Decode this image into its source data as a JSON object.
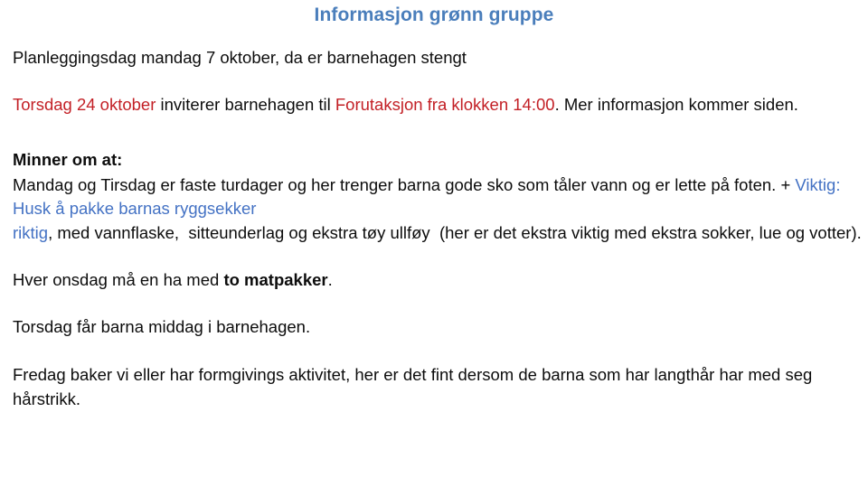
{
  "document": {
    "title": "Informasjon grønn gruppe",
    "title_color": "#4A7EBB",
    "accent_red": "#C32026",
    "accent_blue": "#4472C4",
    "body_color": "#0D0D0D",
    "background": "#FFFFFF"
  },
  "paragraphs": {
    "planning_day": "Planleggingsdag mandag 7 oktober, da er barnehagen stengt",
    "invitation": {
      "date_red": "Torsdag 24 oktober",
      "middle_black": " inviterer barnehagen til ",
      "event_red": "Forutaksjon fra klokken 14:00",
      "tail_black": ". Mer informasjon kommer siden."
    },
    "reminder_heading": "Minner om at:",
    "shoes": {
      "lead_black": "Mandag og Tirsdag er faste turdager og her trenger barna gode sko som tåler vann og er lette på foten. + ",
      "important_blue": "Viktig: Husk å pakke barnas ryggsekker riktig",
      "tail_black": ", med vannflaske,  sitteunderlag og ekstra tøy ullføy  (her er det ekstra viktig med ekstra sokker, lue og votter)."
    },
    "wednesday": {
      "lead": "Hver onsdag må en ha med ",
      "bold": "to matpakker",
      "tail": "."
    },
    "thursday": "Torsdag får barna middag i barnehagen.",
    "friday": "Fredag baker vi eller har formgivings aktivitet, her er det fint dersom de barna som har langthår har med seg hårstrikk."
  }
}
